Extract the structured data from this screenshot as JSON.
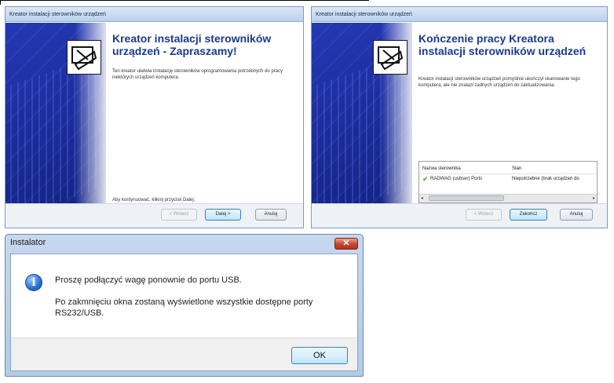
{
  "wizard_welcome": {
    "title": "Kreator instalacji sterowników urządzeń",
    "heading": "Kreator instalacji sterowników urządzeń - Zapraszamy!",
    "description": "Ten kreator ułatwia instalację sterowników oprogramowania potrzebnych do pracy niektórych urządzeń komputera.",
    "continue_text": "Aby kontynuować, kliknij przycisk Dalej.",
    "buttons": {
      "back": "< Wstecz",
      "next": "Dalej >",
      "cancel": "Anuluj"
    }
  },
  "wizard_finish": {
    "title": "Kreator instalacji sterowników urządzeń",
    "heading": "Kończenie pracy Kreatora instalacji sterowników urządzeń",
    "description": "Kreator instalacji sterowników urządzeń pomyślnie ukończył skanowanie tego komputera, ale nie znalazł żadnych urządzeń do zaktualizowania.",
    "table": {
      "headers": [
        "Nazwa sterownika",
        "Stan"
      ],
      "rows": [
        {
          "name": "RADWAG (usbser) Ports",
          "status": "Niepotrzebne (brak urządzeń do"
        }
      ]
    },
    "buttons": {
      "back": "< Wstecz",
      "finish": "Zakończ",
      "cancel": "Anuluj"
    }
  },
  "installer_dialog": {
    "title": "Instalator",
    "message_1": "Proszę podłączyć wagę ponownie do portu USB.",
    "message_2": "Po zakmnięciu okna zostaną wyświetlone wszystkie dostępne porty RS232/USB.",
    "ok_label": "OK",
    "close_glyph": "✕"
  }
}
